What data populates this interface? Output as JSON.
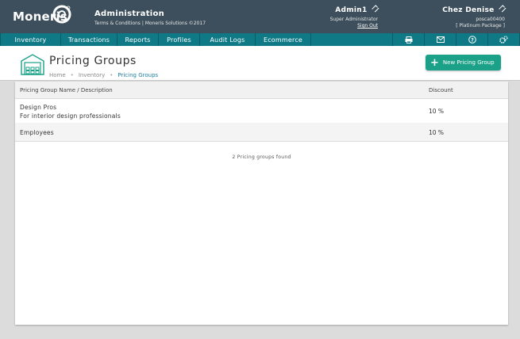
{
  "header": {
    "logo_text": "Moneris",
    "title": "Administration",
    "subtitle": "Terms & Conditions | Moneris Solutions ©2017",
    "user": {
      "name": "Admin1",
      "role": "Super Administrator",
      "signout": "Sign Out"
    },
    "store": {
      "name": "Chez  Denise",
      "id": "posca00400",
      "package": "[ Platinum Package ]"
    }
  },
  "nav": {
    "items": [
      "Inventory",
      "Transactions",
      "Reports",
      "Profiles",
      "Audit  Logs",
      "Ecommerce"
    ],
    "icons": [
      "printer-icon",
      "mail-icon",
      "help-icon",
      "settings-icon"
    ]
  },
  "page": {
    "title": "Pricing  Groups",
    "breadcrumb": [
      "Home",
      "Inventory",
      "Pricing Groups"
    ],
    "new_button": "New  Pricing  Group"
  },
  "table": {
    "headers": [
      "Pricing Group Name / Description",
      "Discount"
    ],
    "rows": [
      {
        "name": "Design Pros",
        "description": "For interior design professionals",
        "discount": "10  %"
      },
      {
        "name": "Employees",
        "description": "",
        "discount": "10  %"
      }
    ],
    "found_text": "2  Pricing  groups  found"
  },
  "colors": {
    "header_bg": "#3d4f5c",
    "nav_bg": "#0f7a86",
    "accent": "#1aa187",
    "link": "#1a7fa0"
  }
}
